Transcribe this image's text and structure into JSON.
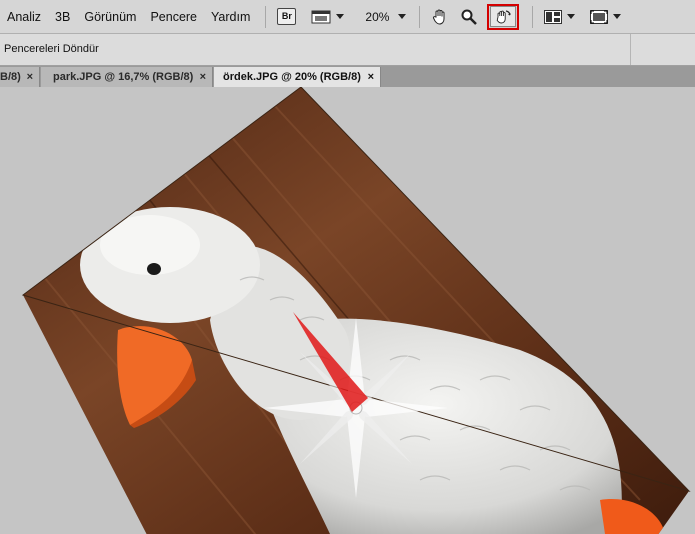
{
  "menu": [
    "Analiz",
    "3B",
    "Görünüm",
    "Pencere",
    "Yardım"
  ],
  "toolbar": {
    "bridge_label": "Br",
    "zoom_level": "20%"
  },
  "options": {
    "label": "Pencereleri Döndür"
  },
  "tabs": [
    {
      "label": "B/8)"
    },
    {
      "label": "park.JPG @ 16,7% (RGB/8)"
    },
    {
      "label": "ördek.JPG @ 20% (RGB/8)"
    }
  ],
  "close_glyph": "×",
  "colors": {
    "highlight": "#d40000",
    "photo_wood": "#6b3a22",
    "compass_needle": "#e01818"
  }
}
